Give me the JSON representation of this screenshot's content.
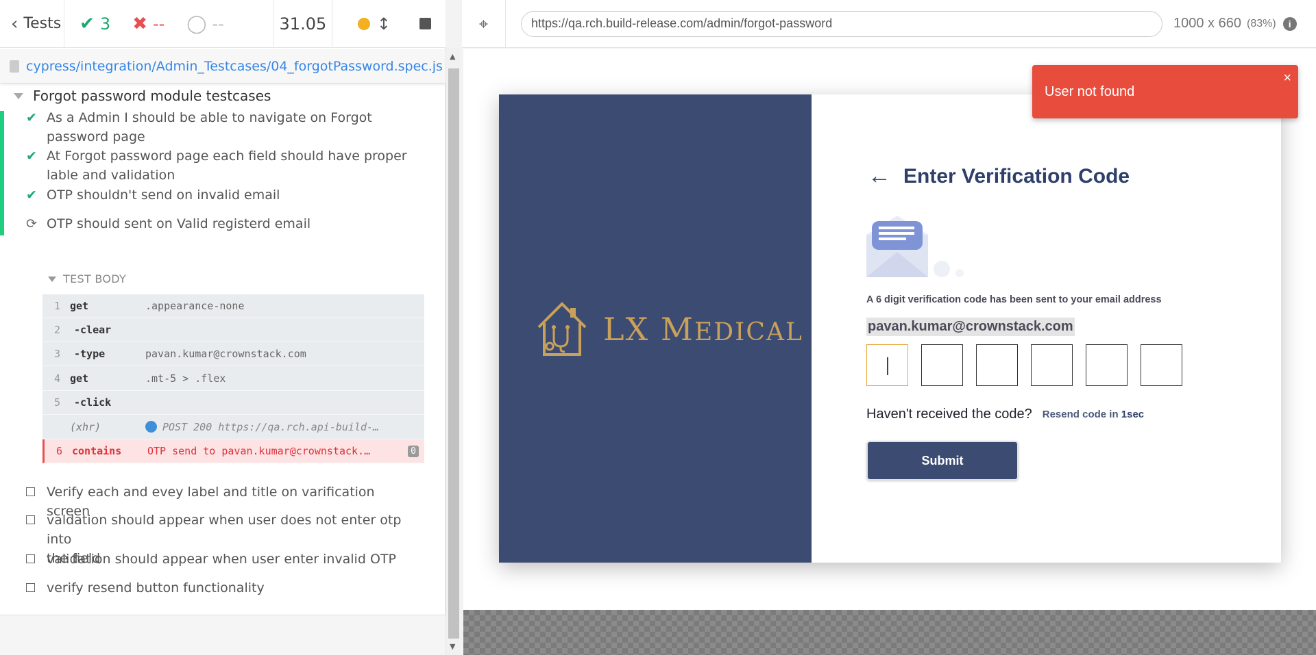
{
  "runner": {
    "tests_label": "Tests",
    "passed": "3",
    "failed": "--",
    "pending": "--",
    "duration": "31.05",
    "spec_path": "cypress/integration/Admin_Testcases/04_forgotPassword.spec.js"
  },
  "suite": {
    "title": "Forgot password module testcases",
    "tests": [
      {
        "state": "passed",
        "line1": "As a Admin I should be able to navigate on Forgot",
        "line2": "password page"
      },
      {
        "state": "passed",
        "line1": "At Forgot password page each field should have proper",
        "line2": "lable and validation"
      },
      {
        "state": "passed",
        "line1": "OTP shouldn't send on invalid email",
        "line2": ""
      },
      {
        "state": "running",
        "line1": "OTP should sent on Valid registerd email",
        "line2": ""
      },
      {
        "state": "pending",
        "line1": "Verify each and evey label and title on varification screen",
        "line2": ""
      },
      {
        "state": "pending",
        "line1": "valdation should appear when user does not enter otp into",
        "line2": "the field"
      },
      {
        "state": "pending",
        "line1": "validation should appear when user enter invalid OTP",
        "line2": ""
      },
      {
        "state": "pending",
        "line1": "verify resend button functionality",
        "line2": ""
      }
    ],
    "test_body_label": "TEST BODY",
    "commands": [
      {
        "num": "1",
        "name": "get",
        "msg": ".appearance-none"
      },
      {
        "num": "2",
        "name": "-clear",
        "msg": ""
      },
      {
        "num": "3",
        "name": "-type",
        "msg": "pavan.kumar@crownstack.com"
      },
      {
        "num": "4",
        "name": "get",
        "msg": ".mt-5 > .flex"
      },
      {
        "num": "5",
        "name": "-click",
        "msg": ""
      },
      {
        "num": "",
        "name": "(xhr)",
        "msg": "POST 200 https://qa.rch.api-build-…"
      },
      {
        "num": "6",
        "name": "contains",
        "msg": "OTP send to pavan.kumar@crownstack.…",
        "badge": "0"
      }
    ]
  },
  "aut": {
    "url": "https://qa.rch.build-release.com/admin/forgot-password",
    "viewport": "1000 x 660",
    "scale": "(83%)",
    "info_icon": "i"
  },
  "app": {
    "logo_text_a": "LX M",
    "logo_text_b": "EDICAL",
    "heading": "Enter Verification Code",
    "sent_message": "A 6 digit verification code has been sent to your email address",
    "email": "pavan.kumar@crownstack.com",
    "otp_count": 6,
    "resend_question": "Haven't received the code?",
    "resend_prefix": "Resend code in",
    "resend_timer": "1sec",
    "submit_label": "Submit",
    "toast_message": "User not found",
    "toast_close": "×",
    "colors": {
      "brand_navy": "#3c4b72",
      "gold": "#c9a15a",
      "toast_red": "#e74c3c",
      "pass_green": "#1fa971"
    }
  }
}
